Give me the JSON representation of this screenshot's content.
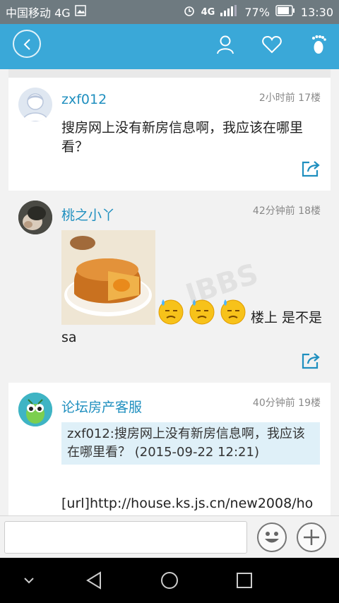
{
  "status": {
    "carrier": "中国移动 4G",
    "network_right": "4G",
    "battery": "77%",
    "time": "13:30"
  },
  "appbar": {
    "back_icon": "chevron-left-icon",
    "icons": [
      "user-icon",
      "heart-icon",
      "footprint-icon"
    ]
  },
  "posts": [
    {
      "user": "zxf012",
      "meta": "2小时前 17楼",
      "text": "搜房网上没有新房信息啊，我应该在哪里看？"
    },
    {
      "user": "桃之小丫",
      "meta": "42分钟前 18楼",
      "text_after": "楼上 是不是sa"
    },
    {
      "user": "论坛房产客服",
      "meta": "40分钟前 19楼",
      "quote": "zxf012:搜房网上没有新房信息啊，我应该在哪里看？ (2015-09-22 12:21)",
      "text": "[url]http://house.ks.js.cn/new2008/ho"
    }
  ],
  "watermark": "IBBS",
  "colors": {
    "accent": "#3aa8d8",
    "username": "#1f8fbf"
  }
}
